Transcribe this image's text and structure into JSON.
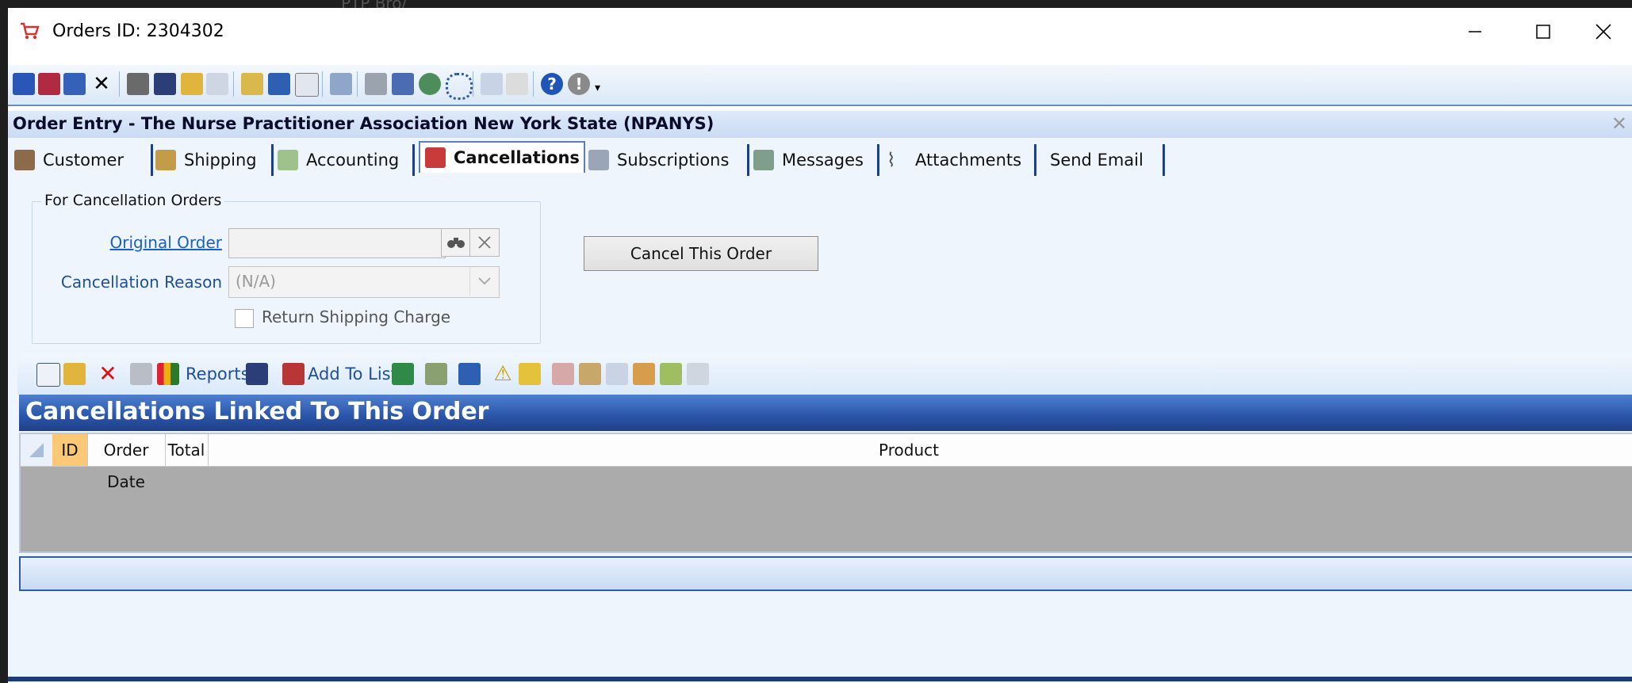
{
  "background": {
    "text": "PTP Bro/"
  },
  "window": {
    "title": "Orders ID: 2304302",
    "controls": {
      "minimize": "–",
      "maximize": "☐",
      "close": "✕"
    }
  },
  "toolbar": {
    "icons": [
      "save-icon",
      "save-close-icon",
      "save-new-icon",
      "delete-icon",
      "print-icon",
      "find-icon",
      "open-folder-icon",
      "list-icon",
      "wizard-icon",
      "refresh-icon",
      "id-icon",
      "link-icon",
      "table-icon",
      "copy-icon",
      "globe-icon",
      "cycle-icon",
      "import-icon",
      "notes-icon",
      "help-icon",
      "info-icon",
      "overflow-icon"
    ]
  },
  "header": {
    "title": "Order Entry - The Nurse Practitioner Association New York State (NPANYS)",
    "close": "✕"
  },
  "tabs": [
    {
      "label": "Customer",
      "icon": "customer-icon"
    },
    {
      "label": "Shipping",
      "icon": "shipping-icon"
    },
    {
      "label": "Accounting",
      "icon": "accounting-icon"
    },
    {
      "label": "Cancellations",
      "icon": "cancellations-icon",
      "active": true
    },
    {
      "label": "Subscriptions",
      "icon": "subscriptions-icon"
    },
    {
      "label": "Messages",
      "icon": "messages-icon"
    },
    {
      "label": "Attachments",
      "icon": "paperclip-icon"
    },
    {
      "label": "Send Email",
      "icon": ""
    }
  ],
  "cancellation_form": {
    "legend": "For Cancellation Orders",
    "original_order_label": "Original Order",
    "original_order_value": "",
    "cancellation_reason_label": "Cancellation Reason",
    "cancellation_reason_value": "(N/A)",
    "return_shipping_label": "Return Shipping Charge",
    "return_shipping_checked": false,
    "cancel_button": "Cancel This Order"
  },
  "grid_toolbar": {
    "reports_label": "Reports",
    "add_to_list_label": "Add To List"
  },
  "grid": {
    "title": "Cancellations Linked To This Order",
    "columns": [
      "ID",
      "Order Date",
      "Total",
      "Product"
    ],
    "rows": []
  },
  "colors": {
    "accent": "#1e3f86",
    "banner": "#2a55a8",
    "link": "#1c5fc5",
    "id_column": "#fbc875"
  }
}
